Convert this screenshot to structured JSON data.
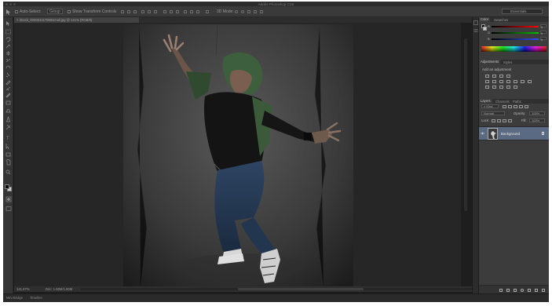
{
  "window": {
    "title": "Adobe Photoshop CS6"
  },
  "options_bar": {
    "auto_select_label": "Auto-Select:",
    "auto_select_target": "Group",
    "show_transform_label": "Show Transform Controls",
    "mode_3d_label": "3D Mode:",
    "workspace": "Essentials"
  },
  "document": {
    "tab_label": "iStock_000004417805Small.jpg @ 141% (RGB/8)"
  },
  "status_bar": {
    "zoom": "141.67%",
    "doc_info": "Doc: 1.60M/1.60M"
  },
  "bottom_tabs": [
    "Mini Bridge",
    "Timeline"
  ],
  "color_panel": {
    "tabs": [
      "Color",
      "Swatches"
    ],
    "channels": [
      "R",
      "G",
      "B"
    ],
    "values": [
      "0",
      "0",
      "0"
    ]
  },
  "adjustments_panel": {
    "tabs": [
      "Adjustments",
      "Styles"
    ],
    "add_label": "Add an adjustment"
  },
  "layers_panel": {
    "tabs": [
      "Layers",
      "Channels",
      "Paths"
    ],
    "kind_label": "Kind",
    "blend_mode": "Normal",
    "opacity_label": "Opacity:",
    "opacity_value": "100%",
    "lock_label": "Lock:",
    "fill_label": "Fill:",
    "fill_value": "100%",
    "layers": [
      {
        "name": "Background",
        "visible": true,
        "locked": true
      }
    ]
  },
  "colors": {
    "ui_dark": "#1d1d1d",
    "panel": "#3c3c3c",
    "selected_layer": "#5a6a82",
    "foreground": "#0a0a0a",
    "background": "#cccccc"
  }
}
